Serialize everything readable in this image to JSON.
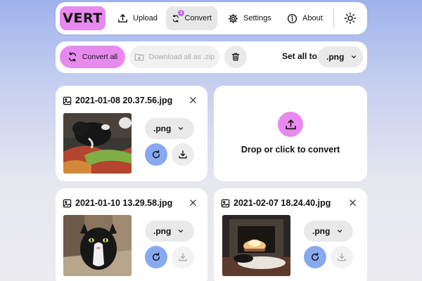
{
  "nav": {
    "logo": "VERT",
    "items": [
      {
        "label": "Upload",
        "icon": "upload-icon"
      },
      {
        "label": "Convert",
        "icon": "refresh-icon",
        "badge": "3",
        "active": true
      },
      {
        "label": "Settings",
        "icon": "gear-icon"
      },
      {
        "label": "About",
        "icon": "info-icon"
      }
    ],
    "theme_icon": "sun-icon"
  },
  "toolbar": {
    "convert_all": "Convert all",
    "download_zip": "Download all as .zip",
    "set_all_label": "Set all to",
    "set_all_value": ".png"
  },
  "files": [
    {
      "name": "2021-01-08 20.37.56.jpg",
      "format": ".png",
      "download_enabled": true
    },
    {
      "name": "2021-01-10 13.29.58.jpg",
      "format": ".png",
      "download_enabled": false
    },
    {
      "name": "2021-02-07 18.24.40.jpg",
      "format": ".png",
      "download_enabled": false
    }
  ],
  "dropzone": {
    "text": "Drop or click to convert"
  },
  "colors": {
    "accent_pink": "#e889ef",
    "accent_blue": "#88a9ef",
    "badge_purple": "#c25ff0"
  }
}
